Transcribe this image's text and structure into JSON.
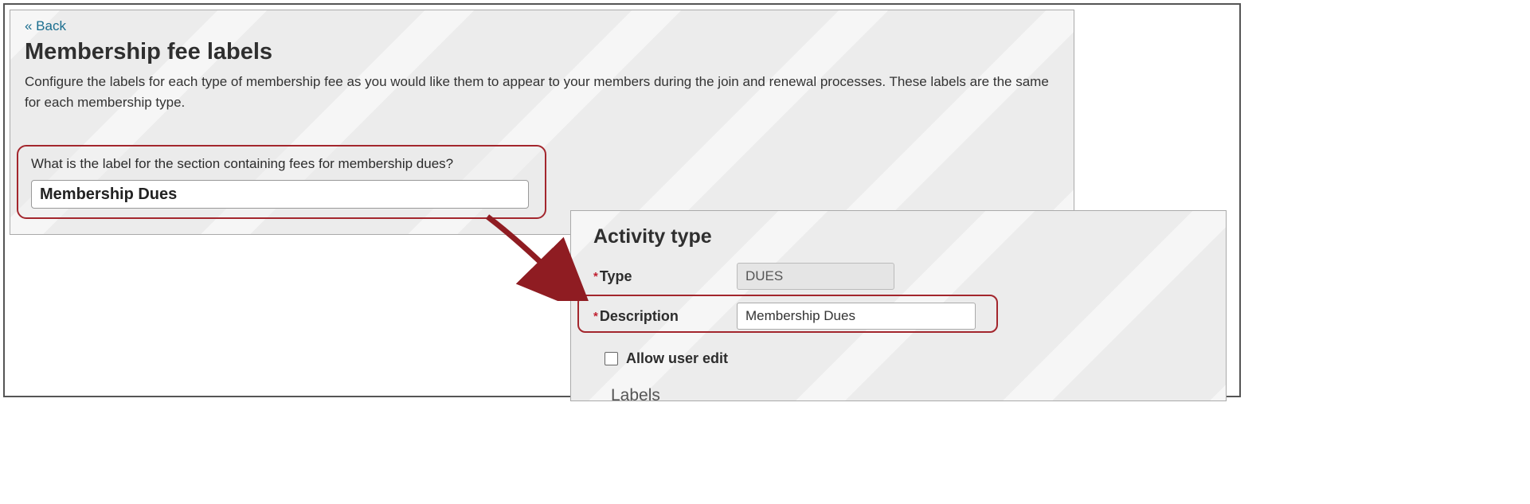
{
  "panel1": {
    "back_label": "« Back",
    "title": "Membership fee labels",
    "description": "Configure the labels for each type of membership fee as you would like them to appear to your members during the join and renewal processes. These labels are the same for each membership type.",
    "question": "What is the label for the section containing fees for membership dues?",
    "input_value": "Membership Dues"
  },
  "panel2": {
    "title": "Activity type",
    "type_label": "Type",
    "type_value": "DUES",
    "description_label": "Description",
    "description_value": "Membership Dues",
    "allow_user_edit_label": "Allow user edit",
    "labels_section": "Labels"
  }
}
